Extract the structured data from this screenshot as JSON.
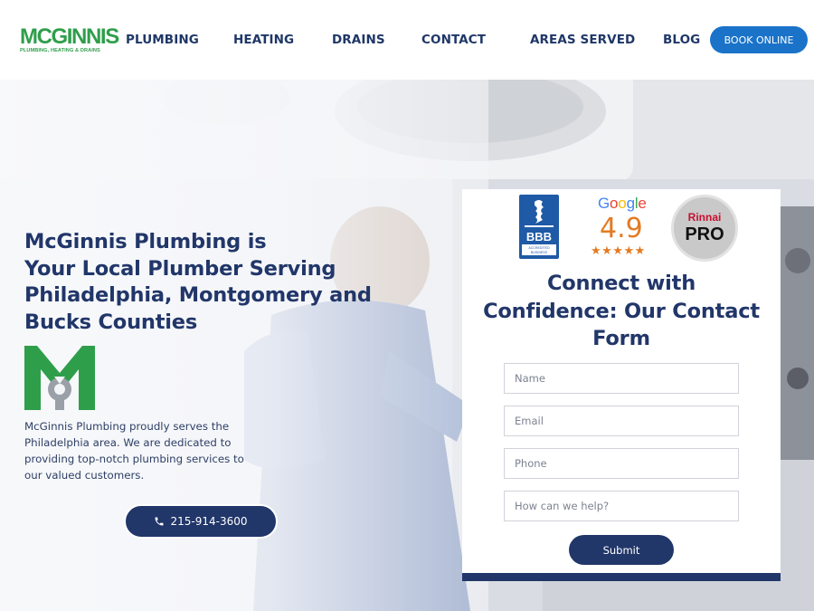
{
  "brand": {
    "logo_text": "MCGINNIS",
    "logo_tagline": "PLUMBING, HEATING & DRAINS",
    "primary_color": "#213669",
    "accent_color": "#1a73c9",
    "logo_green": "#2f9e4b"
  },
  "nav": {
    "items": [
      {
        "label": "PLUMBING"
      },
      {
        "label": "HEATING"
      },
      {
        "label": "DRAINS"
      },
      {
        "label": "CONTACT"
      },
      {
        "label": "AREAS SERVED"
      },
      {
        "label": "BLOG"
      }
    ],
    "book_label": "BOOK ONLINE"
  },
  "hero": {
    "headline_lines": [
      "McGinnis Plumbing is",
      "Your Local Plumber Serving",
      "Philadelphia, Montgomery and",
      "Bucks Counties"
    ],
    "intro": "McGinnis Plumbing proudly serves the Philadelphia area. We are dedicated to providing top-notch plumbing services to our valued customers.",
    "phone_icon": "phone-icon",
    "phone_label": "215-914-3600"
  },
  "badges": {
    "bbb_label": "BBB",
    "bbb_caption": "ACCREDITED BUSINESS",
    "google_label": "Google",
    "google_rating": "4.9",
    "google_stars": "★★★★★",
    "rinnai_label": "Rinnai",
    "rinnai_pro": "PRO"
  },
  "form": {
    "title": "Connect with Confidence: Our Contact Form",
    "name_placeholder": "Name",
    "email_placeholder": "Email",
    "phone_placeholder": "Phone",
    "help_placeholder": "How can we help?",
    "submit_label": "Submit"
  }
}
